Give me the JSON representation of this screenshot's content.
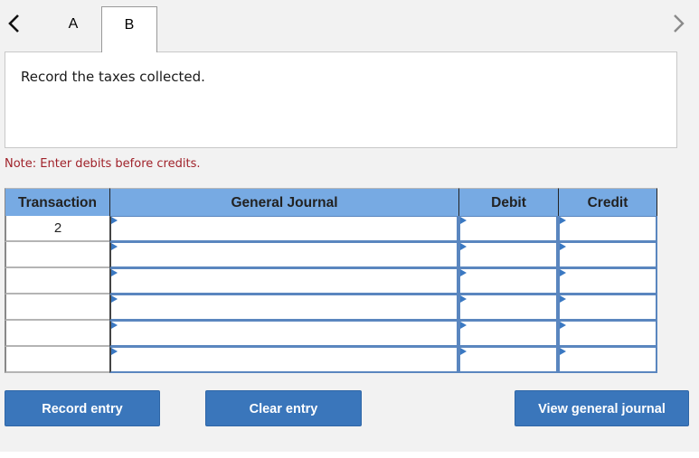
{
  "navigation": {
    "prev_icon": "chevron-left-icon",
    "next_icon": "chevron-right-icon"
  },
  "tabs": [
    {
      "label": "A",
      "active": false
    },
    {
      "label": "B",
      "active": true
    }
  ],
  "prompt": {
    "text": "Record the taxes collected."
  },
  "note": "Note: Enter debits before credits.",
  "journal": {
    "columns": [
      "Transaction",
      "General Journal",
      "Debit",
      "Credit"
    ],
    "rows": [
      {
        "transaction": "2",
        "account": "",
        "debit": "",
        "credit": ""
      },
      {
        "transaction": "",
        "account": "",
        "debit": "",
        "credit": ""
      },
      {
        "transaction": "",
        "account": "",
        "debit": "",
        "credit": ""
      },
      {
        "transaction": "",
        "account": "",
        "debit": "",
        "credit": ""
      },
      {
        "transaction": "",
        "account": "",
        "debit": "",
        "credit": ""
      },
      {
        "transaction": "",
        "account": "",
        "debit": "",
        "credit": ""
      }
    ]
  },
  "buttons": {
    "record": "Record entry",
    "clear": "Clear entry",
    "view": "View general journal"
  },
  "colors": {
    "header_bg": "#77aae3",
    "button_bg": "#3a76bb",
    "note_text": "#a0222a",
    "page_bg": "#f2f2f2"
  }
}
